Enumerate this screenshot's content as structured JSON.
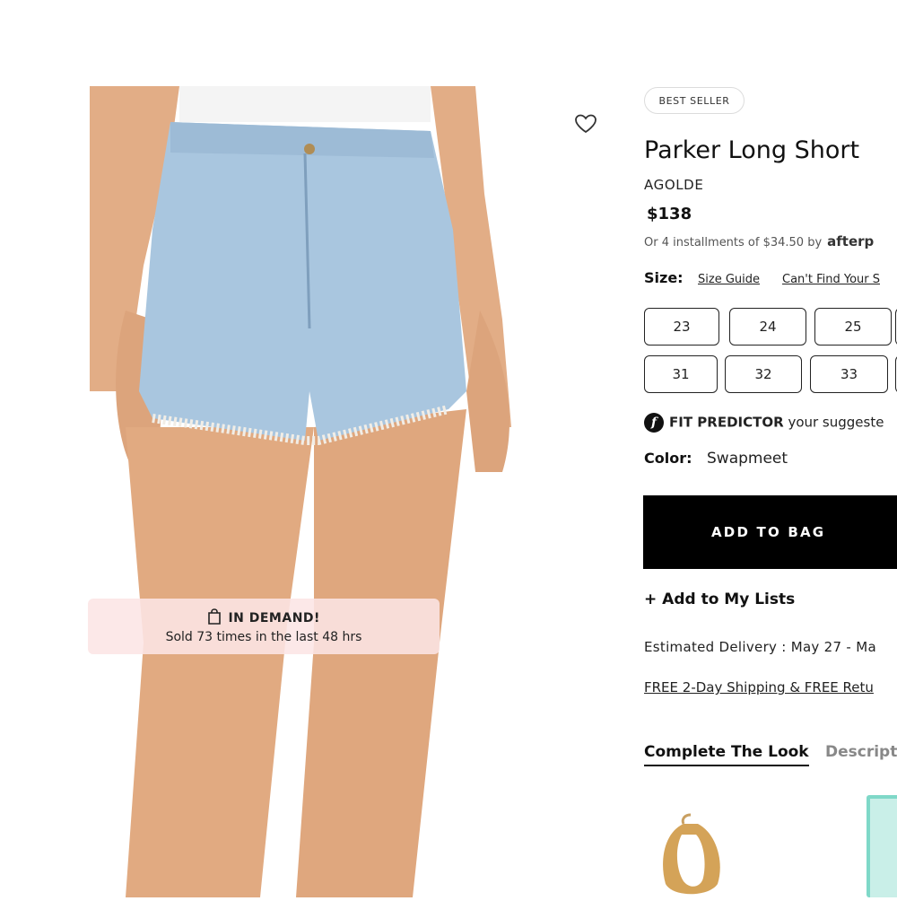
{
  "product": {
    "badge": "BEST SELLER",
    "title": "Parker Long Short",
    "brand": "AGOLDE",
    "price": "$138",
    "installments_text": "Or 4 installments of $34.50 by",
    "installments_provider": "afterp"
  },
  "demand_banner": {
    "title": "IN DEMAND!",
    "subtitle": "Sold 73 times in the last 48 hrs"
  },
  "size": {
    "label": "Size:",
    "guide_link": "Size Guide",
    "cant_find_link": "Can't Find Your S",
    "options_row1": [
      "23",
      "24",
      "25"
    ],
    "options_row2": [
      "31",
      "32",
      "33"
    ]
  },
  "fit_predictor": {
    "label": "FIT PREDICTOR",
    "text": "your suggeste"
  },
  "color": {
    "label": "Color:",
    "value": "Swapmeet"
  },
  "actions": {
    "add_to_bag": "ADD TO BAG",
    "add_to_lists": "+ Add to My Lists"
  },
  "shipping": {
    "delivery": "Estimated Delivery : May 27 - Ma",
    "free_shipping": "FREE 2-Day Shipping & FREE Retu"
  },
  "tabs": [
    {
      "label": "Complete The Look",
      "active": true
    },
    {
      "label": "Descript",
      "active": false
    }
  ],
  "icons": {
    "wishlist": "heart-icon",
    "demand": "shopping-bag-icon",
    "fit_predictor": "fit-predictor-icon"
  }
}
